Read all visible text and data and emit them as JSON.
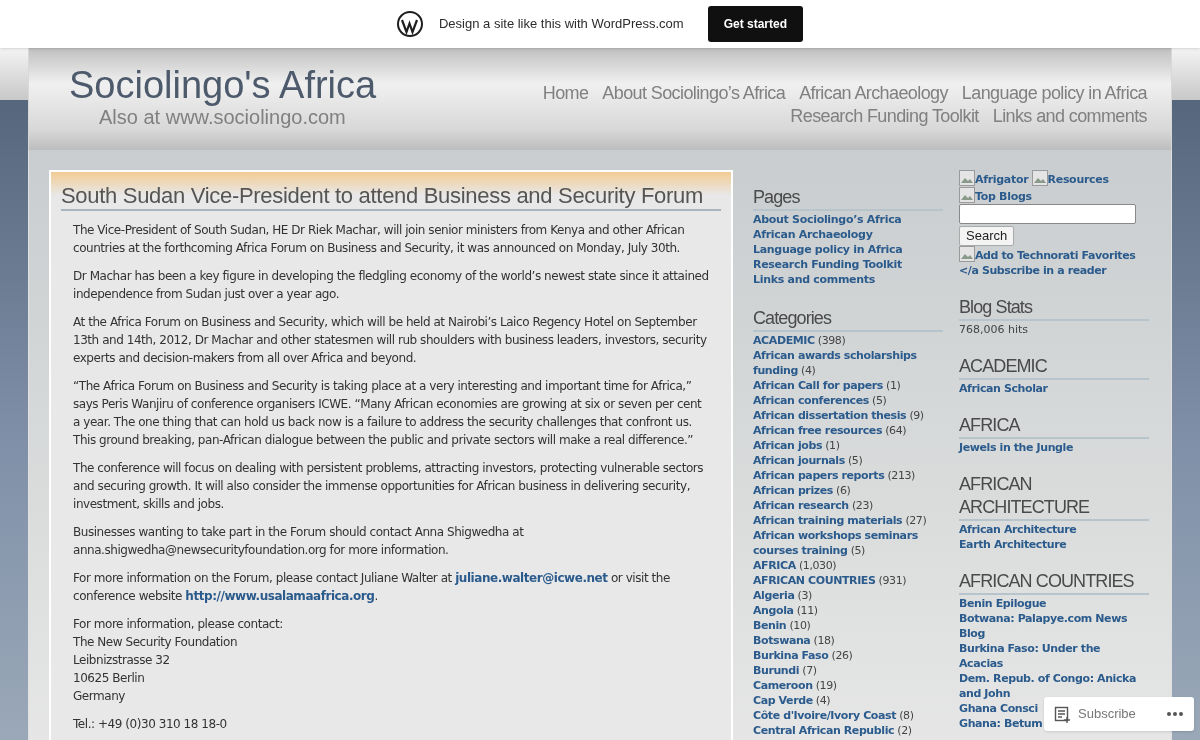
{
  "wp_bar": {
    "text": "Design a site like this with WordPress.com",
    "button": "Get started"
  },
  "header": {
    "title": "Sociolingo's Africa",
    "subtitle": "Also at www.sociolingo.com",
    "nav": [
      "Home",
      "About Sociolingo’s Africa",
      "African Archaeology",
      "Language policy in Africa",
      "Research Funding Toolkit",
      "Links and comments"
    ]
  },
  "article": {
    "title": "South Sudan Vice-President to attend Business and Security Forum",
    "paragraphs": [
      {
        "kind": "text",
        "parts": [
          {
            "kind": "text",
            "text": "The Vice-President of South Sudan, HE Dr Riek Machar, will join senior ministers from Kenya and other African countries at the forthcoming Africa Forum on Business and Security, it was announced on Monday, July 30th."
          }
        ]
      },
      {
        "kind": "text",
        "parts": [
          {
            "kind": "text",
            "text": "Dr Machar has been a key figure in developing the fledgling economy of the world’s newest state since it attained independence from Sudan just over a year ago."
          }
        ]
      },
      {
        "kind": "text",
        "parts": [
          {
            "kind": "text",
            "text": "At the Africa Forum on Business and Security, which will be held at Nairobi’s Laico Regency Hotel on September 13th and 14th, 2012, Dr Machar and other statesmen will rub shoulders with business leaders, investors, security experts and decision-makers from all over Africa and beyond."
          }
        ]
      },
      {
        "kind": "text",
        "parts": [
          {
            "kind": "text",
            "text": "“The Africa Forum on Business and Security is taking place at a very interesting and important time for Africa,” says Peris Wanjiru of conference organisers ICWE. “Many African economies are growing at six or seven per cent a year. The one thing that can hold us back now is a failure to address the security challenges that confront us. This ground breaking, pan-African dialogue between the public and private sectors will make a real difference.”"
          }
        ]
      },
      {
        "kind": "text",
        "parts": [
          {
            "kind": "text",
            "text": "The conference will focus on dealing with persistent problems, attracting investors, protecting vulnerable sectors and securing growth. It will also consider the immense opportunities for African business in delivering security, investment, skills and jobs."
          }
        ]
      },
      {
        "kind": "text",
        "parts": [
          {
            "kind": "text",
            "text": "Businesses wanting to take part in the Forum should contact Anna Shigwedha at anna.shigwedha@newsecurityfoundation.org for more information."
          }
        ]
      },
      {
        "kind": "text",
        "parts": [
          {
            "kind": "text",
            "text": "For more information on the Forum, please contact Juliane Walter at "
          },
          {
            "kind": "link",
            "text": "juliane.walter@icwe.net"
          },
          {
            "kind": "text",
            "text": " or visit the conference website "
          },
          {
            "kind": "link",
            "text": "http://www.usalamaafrica.org"
          },
          {
            "kind": "text",
            "text": "."
          }
        ]
      },
      {
        "kind": "lines",
        "lines": [
          "For more information, please contact:",
          "The New Security Foundation",
          "Leibnizstrasse 32",
          "10625 Berlin",
          "Germany"
        ]
      },
      {
        "kind": "lines",
        "lines": [
          "Tel.: +49 (0)30 310 18 18-0"
        ]
      }
    ]
  },
  "pages": {
    "heading": "Pages",
    "items": [
      "About Sociolingo’s Africa",
      "African Archaeology",
      "Language policy in Africa",
      "Research Funding Toolkit",
      "Links and comments"
    ]
  },
  "categories": {
    "heading": "Categories",
    "items": [
      {
        "name": "ACADEMIC",
        "count": "(398)"
      },
      {
        "name": "African awards scholarships funding",
        "count": "(4)"
      },
      {
        "name": "African Call for papers",
        "count": "(1)"
      },
      {
        "name": "African conferences",
        "count": "(5)"
      },
      {
        "name": "African dissertation thesis",
        "count": "(9)"
      },
      {
        "name": "African free resources",
        "count": "(64)"
      },
      {
        "name": "African jobs",
        "count": "(1)"
      },
      {
        "name": "African journals",
        "count": "(5)"
      },
      {
        "name": "African papers reports",
        "count": "(213)"
      },
      {
        "name": "African prizes",
        "count": "(6)"
      },
      {
        "name": "African research",
        "count": "(23)"
      },
      {
        "name": "African training materials",
        "count": "(27)"
      },
      {
        "name": "African workshops seminars courses training",
        "count": "(5)"
      },
      {
        "name": "AFRICA",
        "count": "(1,030)"
      },
      {
        "name": "AFRICAN COUNTRIES",
        "count": "(931)"
      },
      {
        "name": "Algeria",
        "count": "(3)"
      },
      {
        "name": "Angola",
        "count": "(11)"
      },
      {
        "name": "Benin",
        "count": "(10)"
      },
      {
        "name": "Botswana",
        "count": "(18)"
      },
      {
        "name": "Burkina Faso",
        "count": "(26)"
      },
      {
        "name": "Burundi",
        "count": "(7)"
      },
      {
        "name": "Cameroon",
        "count": "(19)"
      },
      {
        "name": "Cap Verde",
        "count": "(4)"
      },
      {
        "name": "Côte d'Ivoire/Ivory Coast",
        "count": "(8)"
      },
      {
        "name": "Central African Republic",
        "count": "(2)"
      }
    ]
  },
  "badges": [
    "Afrigator",
    "Resources",
    "Top Blogs"
  ],
  "search": {
    "button": "Search"
  },
  "extra_links": [
    {
      "kind": "image",
      "text": "Add to Technorati Favorites"
    },
    {
      "kind": "text",
      "text": "</a Subscribe in a reader"
    }
  ],
  "widgets": [
    {
      "heading": "Blog Stats",
      "kind": "stats",
      "items": [
        "768,006 hits"
      ]
    },
    {
      "heading": "ACADEMIC",
      "kind": "links",
      "items": [
        "African Scholar"
      ]
    },
    {
      "heading": "AFRICA",
      "kind": "links",
      "items": [
        "Jewels in the Jungle"
      ]
    },
    {
      "heading": "AFRICAN ARCHITECTURE",
      "kind": "links",
      "items": [
        "African Architecture",
        "Earth Architecture"
      ]
    },
    {
      "heading": "AFRICAN COUNTRIES",
      "kind": "links",
      "items": [
        "Benin Epilogue",
        "Botwana: Palapye.com News Blog",
        "Burkina Faso: Under the Acacias",
        "Dem. Repub. of Congo: Anicka and John",
        "Ghana Consci",
        "Ghana: Betum"
      ]
    }
  ],
  "subscribe": {
    "label": "Subscribe"
  }
}
